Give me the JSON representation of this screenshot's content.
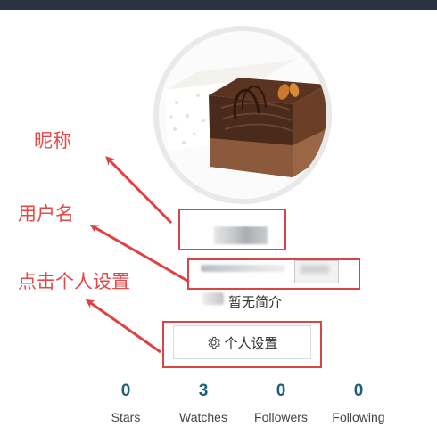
{
  "annotations": {
    "nickname": "昵称",
    "username": "用户名",
    "click_settings": "点击个人设置"
  },
  "profile": {
    "bio": "暂无简介",
    "settings_button": "个人设置"
  },
  "stats": [
    {
      "count": "0",
      "label": "Stars"
    },
    {
      "count": "3",
      "label": "Watches"
    },
    {
      "count": "0",
      "label": "Followers"
    },
    {
      "count": "0",
      "label": "Following"
    }
  ],
  "icons": {
    "settings": "gear-icon"
  },
  "colors": {
    "annotation_red": "#e64848",
    "stat_number": "#1d5f7d"
  }
}
